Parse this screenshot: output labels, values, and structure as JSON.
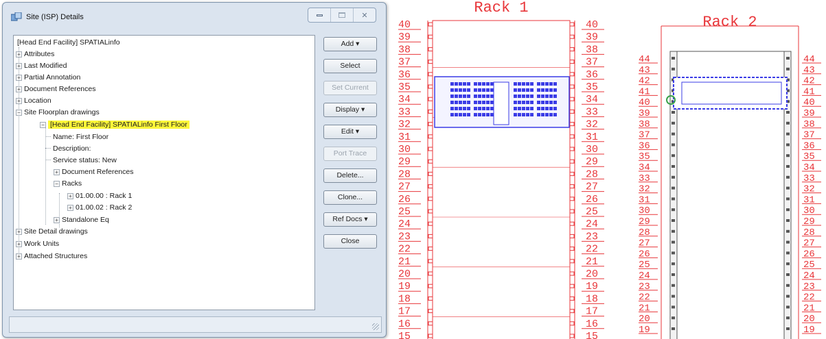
{
  "window": {
    "title": "Site (ISP) Details",
    "controls": {
      "minimize": "",
      "maximize": "",
      "close": "✕"
    }
  },
  "tree": {
    "root": "[Head End Facility] SPATIALinfo",
    "items": {
      "attributes": "Attributes",
      "last_modified": "Last Modified",
      "partial_annotation": "Partial Annotation",
      "document_references": "Document References",
      "location": "Location",
      "site_floorplan_drawings": "Site Floorplan drawings",
      "first_floor": "[Head End Facility] SPATIALinfo First Floor",
      "name": "Name: First Floor",
      "description": "Description:",
      "service_status": "Service status: New",
      "floor_document_references": "Document References",
      "racks": "Racks",
      "rack1": "01.00.00 : Rack 1",
      "rack2": "01.00.02 : Rack 2",
      "standalone_eq": "Standalone Eq",
      "site_detail_drawings": "Site Detail drawings",
      "work_units": "Work Units",
      "attached_structures": "Attached Structures"
    }
  },
  "buttons": {
    "add": "Add ▾",
    "select": "Select",
    "set_current": "Set Current",
    "display": "Display ▾",
    "edit": "Edit ▾",
    "port_trace": "Port Trace",
    "delete": "Delete...",
    "clone": "Clone...",
    "ref_docs": "Ref Docs ▾",
    "close": "Close"
  },
  "drawing": {
    "rack1": {
      "title": "Rack 1",
      "units": [
        40,
        39,
        38,
        37,
        36,
        35,
        34,
        33,
        32,
        31,
        30,
        29,
        28,
        27,
        26,
        25,
        24,
        23,
        22,
        21,
        20,
        19,
        18,
        17,
        16,
        15
      ]
    },
    "rack2": {
      "title": "Rack 2",
      "units": [
        44,
        43,
        42,
        41,
        40,
        39,
        38,
        37,
        36,
        35,
        34,
        33,
        32,
        31,
        30,
        29,
        28,
        27,
        26,
        25,
        24,
        23,
        22,
        21,
        20,
        19
      ]
    },
    "colors": {
      "rack": "#e8363a",
      "equipment": "#3b3ce6",
      "connector": "#3aa14a"
    }
  }
}
